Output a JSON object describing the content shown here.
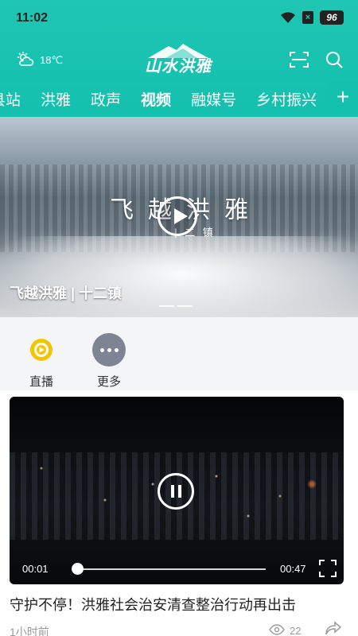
{
  "status_bar": {
    "time": "11:02",
    "battery": "96"
  },
  "header": {
    "temperature": "18℃",
    "logo_text": "山水洪雅",
    "tabs": [
      {
        "label": "县站"
      },
      {
        "label": "洪雅"
      },
      {
        "label": "政声"
      },
      {
        "label": "视频",
        "active": true
      },
      {
        "label": "融媒号"
      },
      {
        "label": "乡村振兴"
      }
    ],
    "add_tab_label": "+"
  },
  "hero": {
    "overlay_title": "飞越洪雅",
    "overlay_subtitle": "| 二 镇",
    "caption": "飞越洪雅 | 十二镇",
    "slide_count": 2
  },
  "quick_entries": [
    {
      "label": "直播",
      "icon": "live-icon"
    },
    {
      "label": "更多",
      "icon": "more-dots-icon"
    }
  ],
  "video_card": {
    "current_time": "00:01",
    "duration": "00:47",
    "progress_fraction": 0.02,
    "headline": "守护不停！洪雅社会治安清查整治行动再出击",
    "published": "1小时前",
    "views": "22"
  },
  "colors": {
    "header_teal": "#1ec6b3",
    "live_icon_yellow": "#f2c500",
    "more_icon_gray": "#7f8495"
  }
}
